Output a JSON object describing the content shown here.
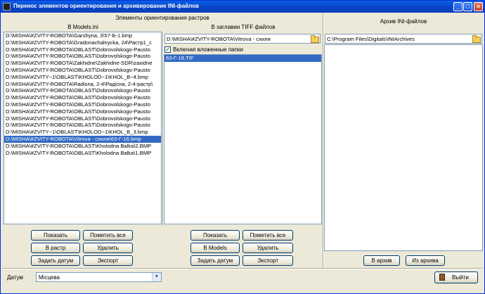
{
  "window": {
    "title": "Перенос элементов ориентирования и архивирование INI-файлов",
    "minimize": "_",
    "maximize": "□",
    "close": "×"
  },
  "sections": {
    "raster_elements": "Элементы ориентирования растров",
    "models_ini": "В Models.ini",
    "tiff_headers": "В заглавии TIFF файлов",
    "archive": "Архив INI-файлов"
  },
  "models_list": {
    "items": [
      "D:\\MISHA\\#ZVITY-ROBOTA\\Garshyna, 3\\57-Б-1.bmp",
      "D:\\MISHA\\#ZVITY-ROBOTA\\Gradonachalnycka, 24\\Растр1_c",
      "D:\\MISHA\\#ZVITY-ROBOTA\\OBLAST\\Dobrovolskogo-Pausto",
      "D:\\MISHA\\#ZVITY-ROBOTA\\OBLAST\\Dobrovolskogo-Pausto",
      "D:\\MISHA\\#ZVITY-ROBOTA\\Zakhidne\\Zakhidne-SDR\\zaxidne",
      "D:\\MISHA\\#ZVITY-ROBOTA\\OBLAST\\Dobrovolskogo-Pausto",
      "D:\\MISHA\\#ZVITY~1\\OBLAST\\KHOLOD~1\\KHOL_B~4.bmp",
      "D:\\MISHA\\#ZVITY-ROBOTA\\Radisna, 2-4\\Радісна, 2-4-растр\\",
      "D:\\MISHA\\#ZVITY-ROBOTA\\OBLAST\\Dobrovolskogo-Pausto",
      "D:\\MISHA\\#ZVITY-ROBOTA\\OBLAST\\Dobrovolskogo-Pausto",
      "D:\\MISHA\\#ZVITY-ROBOTA\\OBLAST\\Dobrovolskogo-Pausto",
      "D:\\MISHA\\#ZVITY-ROBOTA\\OBLAST\\Dobrovolskogo-Pausto",
      "D:\\MISHA\\#ZVITY-ROBOTA\\OBLAST\\Dobrovolskogo-Pausto",
      "D:\\MISHA\\#ZVITY-ROBOTA\\OBLAST\\Dobrovolskogo-Pausto",
      "D:\\MISHA\\#ZVITY~1\\OBLAST\\KHOLOD~1\\KHOL_B_3.bmp",
      "D:\\MISHA\\#ZVITY-ROBOTA\\Vitrova - схили\\63-Г-16.bmp",
      "D:\\MISHA\\#ZVITY-ROBOTA\\OBLAST\\Kholodna Balka\\2.BMP",
      "D:\\MISHA\\#ZVITY-ROBOTA\\OBLAST\\Kholodna Balka\\1.BMP"
    ],
    "selected_index": 15
  },
  "tiff": {
    "path": "D:\\MISHA\\#ZVITY-ROBOTA\\Vitrova - схили",
    "include_subfolders_label": "Включая вложенные папки",
    "include_subfolders_checked": "✓",
    "files": [
      "63-Г-16.TIF"
    ]
  },
  "archive": {
    "path": "C:\\Program Files\\Digitals\\INIArchives",
    "to_archive": "В архив",
    "from_archive": "Из архива"
  },
  "models_buttons": {
    "show": "Показать",
    "mark_all": "Пометить все",
    "to_raster": "В растр",
    "delete": "Удалить",
    "set_datum": "Задать датум",
    "export": "Экспорт"
  },
  "tiff_buttons": {
    "show": "Показать",
    "mark_all": "Пометить все",
    "to_models": "В Models",
    "delete": "Удалить",
    "set_datum": "Задать датум",
    "export": "Экспорт"
  },
  "footer": {
    "datum_label": "Датум",
    "datum_value": "Місцева",
    "exit": "Выйти"
  }
}
